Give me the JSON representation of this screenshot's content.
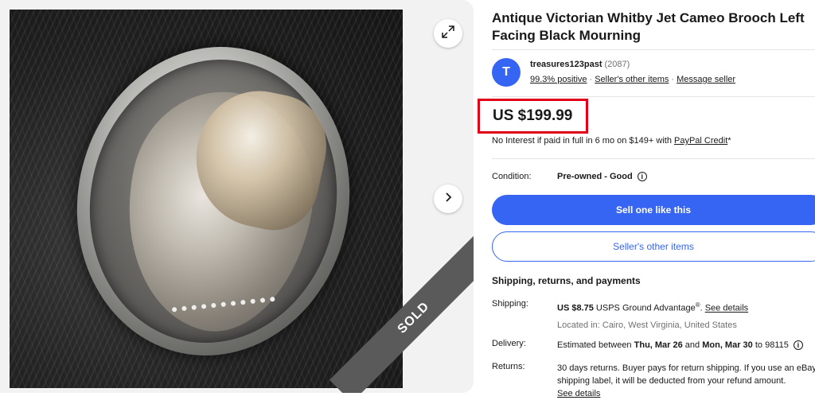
{
  "gallery": {
    "image_alt": "Antique Victorian Whitby Jet Cameo Brooch",
    "sold_label": "SOLD",
    "expand_icon": "expand-icon",
    "next_icon": "chevron-right-icon"
  },
  "listing": {
    "title": "Antique Victorian Whitby Jet Cameo Brooch Left Facing Black Mourning"
  },
  "seller": {
    "avatar_letter": "T",
    "name": "treasures123past",
    "feedback_count": "(2087)",
    "positive": "99.3% positive",
    "other_items": "Seller's other items",
    "message": "Message seller"
  },
  "price": {
    "value": "US $199.99",
    "credit_text": "No Interest if paid in full in 6 mo on $149+ with ",
    "credit_link": "PayPal Credit",
    "credit_suffix": "*"
  },
  "condition": {
    "label": "Condition:",
    "value": "Pre-owned - Good"
  },
  "buttons": {
    "sell_like_this": "Sell one like this",
    "sellers_other_items": "Seller's other items"
  },
  "shipping": {
    "heading": "Shipping, returns, and payments",
    "shipping_label": "Shipping:",
    "shipping_price": "US $8.75",
    "shipping_service": " USPS Ground Advantage",
    "shipping_reg": "®",
    "shipping_link": "See details",
    "location": "Located in: Cairo, West Virginia, United States",
    "delivery_label": "Delivery:",
    "delivery_prefix": "Estimated between ",
    "delivery_start": "Thu, Mar 26",
    "delivery_and": " and ",
    "delivery_end": "Mon, Mar 30",
    "delivery_suffix": " to 98115",
    "returns_label": "Returns:",
    "returns_text": "30 days returns. Buyer pays for return shipping. If you use an eBay shipping label, it will be deducted from your refund amount.",
    "returns_link": "See details"
  },
  "colors": {
    "accent": "#3665f3",
    "highlight_border": "#e0001a",
    "sold_band": "#5a5a5a"
  }
}
